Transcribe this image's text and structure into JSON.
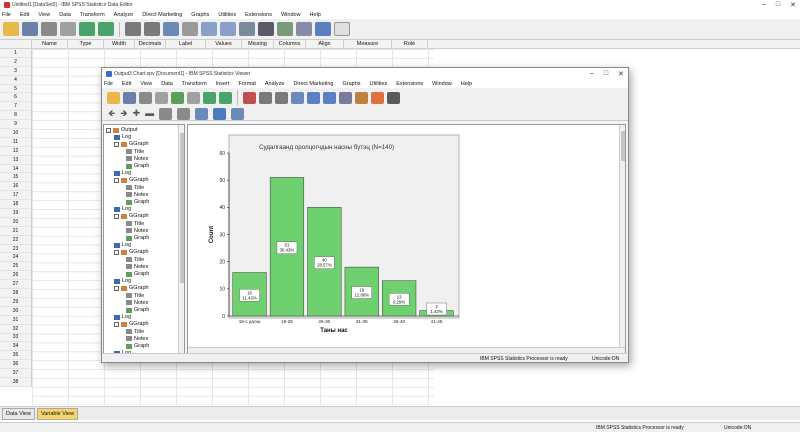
{
  "editor": {
    "title": "Untitled1 [DataSet0] - IBM SPSS Statistics Data Editor",
    "menu": [
      "File",
      "Edit",
      "View",
      "Data",
      "Transform",
      "Analyze",
      "Direct Marketing",
      "Graphs",
      "Utilities",
      "Extensions",
      "Window",
      "Help"
    ],
    "columns": [
      "Name",
      "Type",
      "Width",
      "Decimals",
      "Label",
      "Values",
      "Missing",
      "Columns",
      "Align",
      "Measure",
      "Role"
    ],
    "rows": [
      "1",
      "2",
      "3",
      "4",
      "5",
      "6",
      "7",
      "8",
      "9",
      "10",
      "11",
      "12",
      "13",
      "14",
      "15",
      "16",
      "17",
      "18",
      "19",
      "20",
      "21",
      "22",
      "23",
      "24",
      "25",
      "26",
      "27",
      "28",
      "29",
      "30",
      "31",
      "32",
      "33",
      "34",
      "35",
      "36",
      "37",
      "38"
    ],
    "tabs": [
      "Data View",
      "Variable View"
    ],
    "active_tab": "Variable View",
    "status_processor": "IBM SPSS Statistics Processor is ready",
    "status_unicode": "Unicode:ON",
    "accent_color": "#f5d56a"
  },
  "viewer": {
    "title": "Output3 Chart.spv [Document1] - IBM SPSS Statistics Viewer",
    "menu": [
      "File",
      "Edit",
      "View",
      "Data",
      "Transform",
      "Insert",
      "Format",
      "Analyze",
      "Direct Marketing",
      "Graphs",
      "Utilities",
      "Extensions",
      "Window",
      "Help"
    ],
    "outline": {
      "root": "Output",
      "items": [
        {
          "label": "Log",
          "level": 1
        },
        {
          "label": "GGraph",
          "level": 1
        },
        {
          "label": "Title",
          "level": 2
        },
        {
          "label": "Notes",
          "level": 2
        },
        {
          "label": "Graph",
          "level": 2
        },
        {
          "label": "Log",
          "level": 1
        },
        {
          "label": "GGraph",
          "level": 1
        },
        {
          "label": "Title",
          "level": 2
        },
        {
          "label": "Notes",
          "level": 2
        },
        {
          "label": "Graph",
          "level": 2
        },
        {
          "label": "Log",
          "level": 1
        },
        {
          "label": "GGraph",
          "level": 1
        },
        {
          "label": "Title",
          "level": 2
        },
        {
          "label": "Notes",
          "level": 2
        },
        {
          "label": "Graph",
          "level": 2
        },
        {
          "label": "Log",
          "level": 1
        },
        {
          "label": "GGraph",
          "level": 1
        },
        {
          "label": "Title",
          "level": 2
        },
        {
          "label": "Notes",
          "level": 2
        },
        {
          "label": "Graph",
          "level": 2
        },
        {
          "label": "Log",
          "level": 1
        },
        {
          "label": "GGraph",
          "level": 1
        },
        {
          "label": "Title",
          "level": 2
        },
        {
          "label": "Notes",
          "level": 2
        },
        {
          "label": "Graph",
          "level": 2
        },
        {
          "label": "Log",
          "level": 1
        },
        {
          "label": "GGraph",
          "level": 1
        },
        {
          "label": "Title",
          "level": 2
        },
        {
          "label": "Notes",
          "level": 2
        },
        {
          "label": "Graph",
          "level": 2
        },
        {
          "label": "Log",
          "level": 1
        }
      ]
    },
    "status_processor": "IBM SPSS Statistics Processor is ready",
    "status_unicode": "Unicode:ON"
  },
  "chart_data": {
    "type": "bar",
    "title": "Судалгаанд оролцогчдын насны бүтэц (N=140)",
    "xlabel": "Таны нас",
    "ylabel": "Count",
    "categories": [
      "18-с доош",
      "19-25",
      "26-30",
      "31-35",
      "36-40",
      "41-45"
    ],
    "values": [
      16,
      51,
      40,
      18,
      13,
      2
    ],
    "labels": [
      "16\n11.43%",
      "51\n36.43%",
      "40\n28.57%",
      "18\n12.86%",
      "13\n9.29%",
      "2\n1.43%"
    ],
    "ylim": [
      0,
      60
    ],
    "yticks": [
      0,
      10,
      20,
      30,
      40,
      50,
      60
    ],
    "bar_color": "#6fd06f",
    "plot_bg": "#f0f0f0"
  }
}
